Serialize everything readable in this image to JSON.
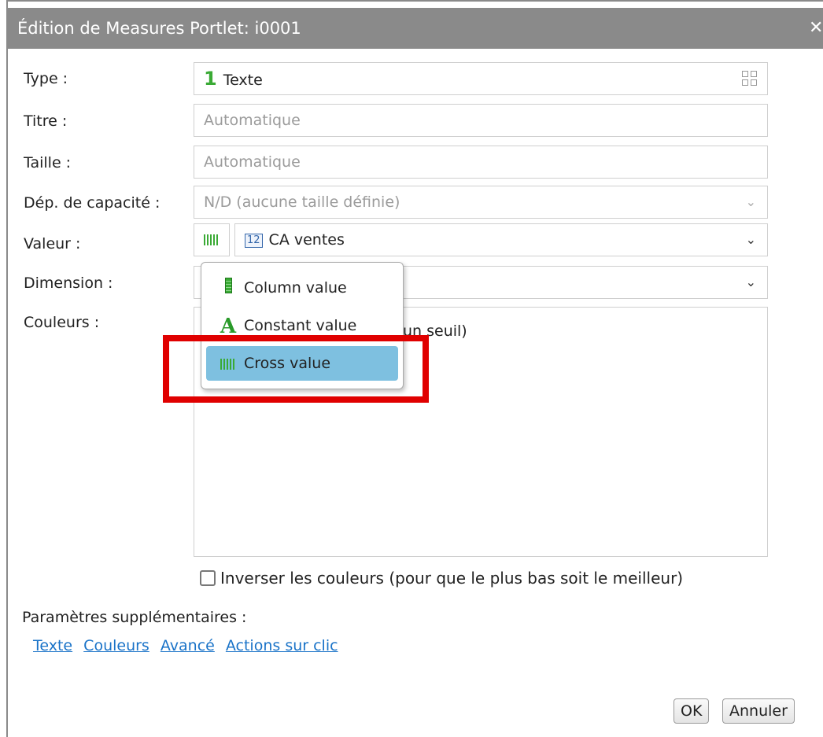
{
  "dialog": {
    "title": "Édition de Measures Portlet: i0001",
    "close": "✕"
  },
  "form": {
    "type_label": "Type :",
    "type_num": "1",
    "type_value": "Texte",
    "title_label": "Titre :",
    "title_placeholder": "Automatique",
    "size_label": "Taille :",
    "size_placeholder": "Automatique",
    "capacity_label": "Dép. de capacité :",
    "capacity_value": "N/D (aucune taille définie)",
    "value_label": "Valeur :",
    "value_badge": "12",
    "value_value": "CA ventes",
    "dimension_label": "Dimension :",
    "colors_label": "Couleurs :",
    "colors_partial": "un seuil)",
    "invert_label": "Inverser les couleurs (pour que le plus bas soit le meilleur)"
  },
  "extra": {
    "label": "Paramètres supplémentaires :",
    "links": [
      "Texte",
      "Couleurs",
      "Avancé",
      "Actions sur clic"
    ]
  },
  "buttons": {
    "ok": "OK",
    "cancel": "Annuler"
  },
  "value_menu": {
    "items": [
      {
        "label": "Column value",
        "icon": "column-value-icon"
      },
      {
        "label": "Constant value",
        "icon": "constant-a-icon",
        "glyph": "A"
      },
      {
        "label": "Cross value",
        "icon": "cross-value-icon",
        "selected": true
      }
    ]
  },
  "colors": {
    "accent_green": "#3aaa35",
    "selected_bg": "#7ec0e0",
    "highlight_red": "#e00000",
    "link": "#1a73c8"
  }
}
